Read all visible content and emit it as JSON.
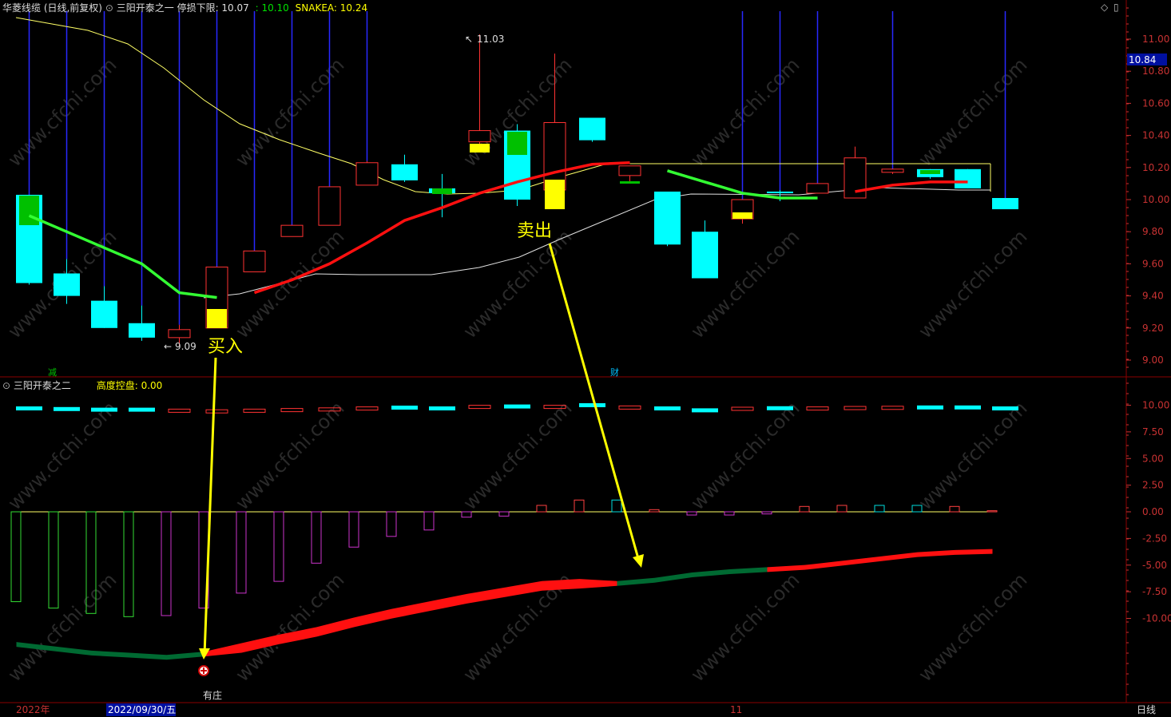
{
  "main_panel": {
    "title": "华菱线缆 (日线,前复权)",
    "indicator": "三阳开泰之一",
    "stop_label": "停损下限: 10.07",
    "val2": ": 10.10",
    "snakea": "SNAKEA: 10.24",
    "high_label": "11.03",
    "low_label": "9.09",
    "current_price": "10.84",
    "buy_label": "买入",
    "sell_label": "卖出",
    "event_jian": "减",
    "event_cai": "财",
    "y_ticks": [
      "11.00",
      "10.80",
      "10.60",
      "10.40",
      "10.20",
      "10.00",
      "9.80",
      "9.60",
      "9.40",
      "9.20",
      "9.00"
    ]
  },
  "sub_panel": {
    "indicator": "三阳开泰之二",
    "kongpan": "高度控盘: 0.00",
    "youzhuang": "有庄",
    "y_ticks": [
      "10.00",
      "7.50",
      "5.00",
      "2.50",
      "0.00",
      "-2.50",
      "-5.00",
      "-7.50",
      "-10.00"
    ]
  },
  "footer": {
    "year": "2022年",
    "date": "2022/09/30/五",
    "month": "11",
    "period": "日线"
  },
  "colors": {
    "up": "#ff3232",
    "down": "#00ffff",
    "yellow": "#ffff00",
    "green": "#00e000",
    "grid_red": "#8b0000",
    "axis_text": "#c83232"
  },
  "chart_data": {
    "type": "candlestick",
    "candles": [
      {
        "o": 10.03,
        "h": 10.03,
        "l": 9.47,
        "c": 9.48,
        "ma": 9.9
      },
      {
        "o": 9.54,
        "h": 9.63,
        "l": 9.35,
        "c": 9.4,
        "ma": 9.8
      },
      {
        "o": 9.37,
        "h": 9.46,
        "l": 9.2,
        "c": 9.2,
        "ma": 9.7
      },
      {
        "o": 9.23,
        "h": 9.34,
        "l": 9.12,
        "c": 9.14,
        "ma": 9.6
      },
      {
        "o": 9.14,
        "h": 9.22,
        "l": 9.09,
        "c": 9.19,
        "ma": 9.42
      },
      {
        "o": 9.2,
        "h": 9.58,
        "l": 9.2,
        "c": 9.58,
        "ma": 9.39
      },
      {
        "o": 9.55,
        "h": 9.68,
        "l": 9.55,
        "c": 9.68,
        "ma": 9.42
      },
      {
        "o": 9.77,
        "h": 9.84,
        "l": 9.77,
        "c": 9.84,
        "ma": 9.5
      },
      {
        "o": 9.84,
        "h": 10.08,
        "l": 9.84,
        "c": 10.08,
        "ma": 9.6
      },
      {
        "o": 10.09,
        "h": 10.24,
        "l": 10.09,
        "c": 10.23,
        "ma": 9.73
      },
      {
        "o": 10.22,
        "h": 10.28,
        "l": 10.11,
        "c": 10.12,
        "ma": 9.87
      },
      {
        "o": 10.07,
        "h": 10.16,
        "l": 9.89,
        "c": 10.04,
        "ma": 9.95
      },
      {
        "o": 10.36,
        "h": 11.03,
        "l": 10.3,
        "c": 10.43,
        "ma": 10.04
      },
      {
        "o": 10.43,
        "h": 10.47,
        "l": 9.96,
        "c": 10.0,
        "ma": 10.11
      },
      {
        "o": 10.06,
        "h": 10.91,
        "l": 9.96,
        "c": 10.48,
        "ma": 10.17
      },
      {
        "o": 10.51,
        "h": 10.51,
        "l": 10.36,
        "c": 10.37,
        "ma": 10.22
      },
      {
        "o": 10.15,
        "h": 10.21,
        "l": 10.1,
        "c": 10.21,
        "ma": 10.23
      },
      {
        "o": 10.05,
        "h": 10.05,
        "l": 9.71,
        "c": 9.72,
        "ma": 10.18
      },
      {
        "o": 9.8,
        "h": 9.87,
        "l": 9.51,
        "c": 9.51,
        "ma": 10.11
      },
      {
        "o": 9.88,
        "h": 10.0,
        "l": 9.85,
        "c": 10.0,
        "ma": 10.04
      },
      {
        "o": 10.05,
        "h": 10.06,
        "l": 9.99,
        "c": 10.04,
        "ma": 10.01
      },
      {
        "o": 10.04,
        "h": 10.1,
        "l": 10.04,
        "c": 10.1,
        "ma": 10.01
      },
      {
        "o": 10.01,
        "h": 10.33,
        "l": 10.01,
        "c": 10.26,
        "ma": 10.05
      },
      {
        "o": 10.17,
        "h": 10.19,
        "l": 10.16,
        "c": 10.19,
        "ma": 10.09
      },
      {
        "o": 10.19,
        "h": 10.19,
        "l": 10.13,
        "c": 10.14,
        "ma": 10.11
      },
      {
        "o": 10.19,
        "h": 10.19,
        "l": 10.07,
        "c": 10.07,
        "ma": 10.11
      },
      {
        "o": 10.01,
        "h": 10.01,
        "l": 9.94,
        "c": 9.94,
        "ma": 10.1
      }
    ],
    "sub_bars": [
      -8.4,
      -9,
      -9.5,
      -9.8,
      -9.7,
      -9,
      -7.6,
      -6.5,
      -4.8,
      -3.3,
      -2.3,
      -1.7,
      -0.5,
      -0.4,
      0.6,
      1.1,
      1.1,
      0.2,
      -0.3,
      -0.3,
      -0.2,
      0.5,
      0.6,
      0.6,
      0.6,
      0.5,
      0.1
    ],
    "sub_line": [
      -12.4,
      -12.8,
      -13.2,
      -13.4,
      -13.6,
      -13.3,
      -12.8,
      -12.0,
      -11.3,
      -10.4,
      -9.6,
      -8.9,
      -8.2,
      -7.6,
      -7.0,
      -6.8,
      -6.7,
      -6.4,
      -5.9,
      -5.6,
      -5.4,
      -5.2,
      -4.8,
      -4.4,
      -4.0,
      -3.8,
      -3.7
    ],
    "sub_top_values": [
      10.0,
      9.9,
      9.8,
      9.8,
      9.7,
      9.6,
      9.7,
      9.8,
      9.9,
      10.05,
      10.12,
      10.0,
      10.3,
      10.3,
      10.3,
      10.5,
      10.2,
      10.0,
      9.7,
      10.0,
      10.03,
      10.05,
      10.12,
      10.15,
      10.15,
      10.15,
      10.0
    ]
  }
}
